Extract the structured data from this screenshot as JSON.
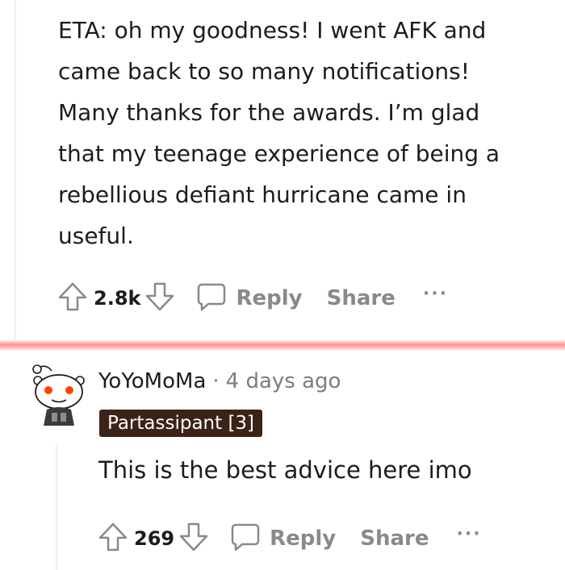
{
  "parent_comment": {
    "body_lines": [
      "ETA: oh my goodness! I went AFK and",
      "came back to so many notifications!",
      "Many thanks for the awards. I’m glad",
      "that my teenage experience of being a",
      "rebellious defiant hurricane came in",
      "useful."
    ],
    "votes": "2.8k",
    "reply_label": "Reply",
    "share_label": "Share",
    "more_label": "···"
  },
  "reply_comment": {
    "username": "YoYoMoMa",
    "separator": "·",
    "time": "4 days ago",
    "flair": "Partassipant [3]",
    "body": "This is the best advice here imo",
    "votes": "269",
    "reply_label": "Reply",
    "share_label": "Share",
    "more_label": "···"
  },
  "colors": {
    "text": "#1c1c1c",
    "muted": "#878a8c",
    "flair_bg": "#3a2417",
    "divider": "#ff6e6e",
    "avatar_eye": "#ff4500"
  },
  "icons": [
    "upvote-arrow",
    "downvote-arrow",
    "speech-bubble",
    "reddit-snoo-avatar"
  ]
}
